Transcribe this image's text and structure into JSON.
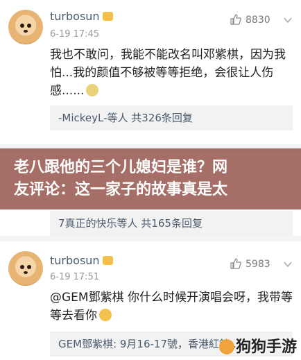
{
  "comments": [
    {
      "user": "turbosun",
      "time": "6-19 17:45",
      "likes": "8830",
      "body": "我也不敢问，我能不能改名叫邓紫棋，因为我怕...我的颜值不够被等等拒绝，会很让人伤感......",
      "reply": "-MickeyL-等人 共326条回复"
    },
    {
      "reply": "7真正的快乐等人 共165条回复"
    },
    {
      "user": "turbosun",
      "time": "6-19 17:51",
      "likes": "5983",
      "body": "@GEM鄧紫棋 你什么时候开演唱会呀，我带等等去看你",
      "reply": "GEM鄧紫棋: 9月16-17號，香港紅館…"
    }
  ],
  "overlay": {
    "title_line1": "老八跟他的三个儿媳妇是谁？网",
    "title_line2": "友评论：这一家子的故事真是太"
  },
  "watermark": "狗狗手游",
  "icons": {
    "like": "thumbs-up-icon",
    "more": "chevron-down-icon",
    "badge": "verified-badge-icon"
  },
  "colors": {
    "username": "#4a5b6d",
    "overlay": "#8c463c",
    "reply_bg": "#f2f2f2"
  }
}
